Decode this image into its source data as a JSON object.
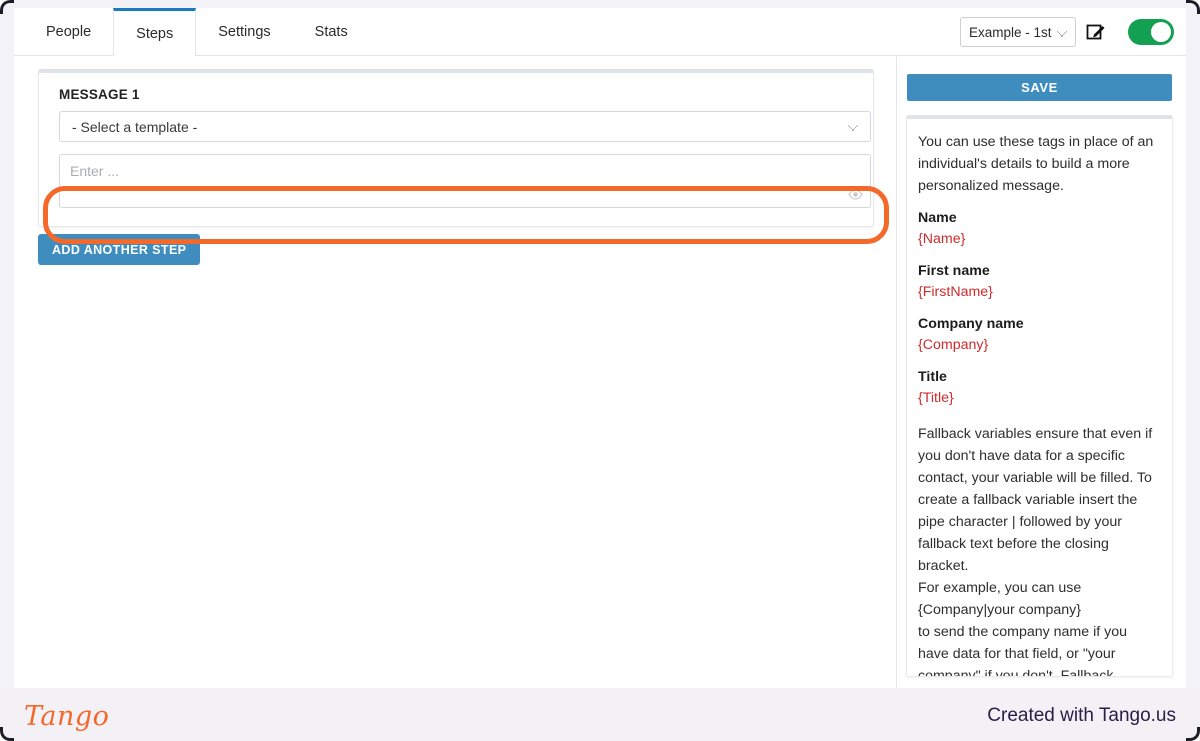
{
  "header": {
    "tabs": [
      {
        "label": "People",
        "active": false
      },
      {
        "label": "Steps",
        "active": true
      },
      {
        "label": "Settings",
        "active": false
      },
      {
        "label": "Stats",
        "active": false
      }
    ],
    "sequence_select": {
      "value": "Example - 1st",
      "options": [
        "Example - 1st"
      ]
    },
    "edit_icon": "edit-pencil-icon",
    "toggle": {
      "state": "on",
      "color": "#13a052"
    }
  },
  "main": {
    "message_card": {
      "title": "MESSAGE 1",
      "template_select": {
        "value": "- Select a template -",
        "options": [
          "- Select a template -"
        ]
      },
      "editor": {
        "value": "",
        "placeholder": "Enter ..."
      },
      "preview_icon": "eye-icon"
    },
    "add_step_label": "ADD ANOTHER STEP"
  },
  "sidebar": {
    "save_label": "SAVE",
    "intro": "You can use these tags in place of an individual's details to build a more personalized message.",
    "tags": [
      {
        "label": "Name",
        "value": "{Name}"
      },
      {
        "label": "First name",
        "value": "{FirstName}"
      },
      {
        "label": "Company name",
        "value": "{Company}"
      },
      {
        "label": "Title",
        "value": "{Title}"
      }
    ],
    "fallback_part1": "Fallback variables ensure that even if you don't have data for a specific contact, your variable will be filled. To create a fallback variable insert the pipe character | followed by your fallback text before the closing bracket.",
    "fallback_part2": "For example, you can use",
    "fallback_example": "{Company|your company}",
    "fallback_part3": "to send the company name if you have data for that field, or \"your company\" if you don't. Fallback variables are available for name, first name, company, title."
  },
  "footer": {
    "logo_text": "Tango",
    "credit": "Created with Tango.us"
  },
  "highlights": {
    "color": "#f4682a",
    "targets": [
      "message-editor",
      "save-button"
    ]
  }
}
